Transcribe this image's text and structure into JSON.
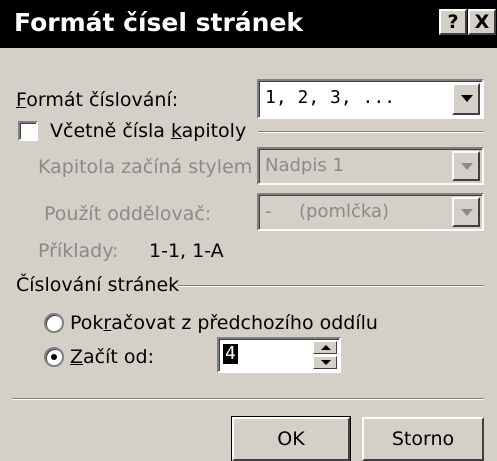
{
  "window": {
    "title": "Formát čísel stránek",
    "help_button": "?",
    "close_button": "X"
  },
  "number_format": {
    "label_first": "F",
    "label_rest": "ormát číslování:",
    "value": "1, 2, 3, ..."
  },
  "include_chapter": {
    "label_pre": "Včetně čísla ",
    "label_underline": "k",
    "label_post": "apitoly",
    "checked": false
  },
  "chapter_style": {
    "label": "Kapitola začíná stylem",
    "value": "Nadpis 1"
  },
  "separator": {
    "label": "Použít oddělovač:",
    "value_symbol": "-",
    "value_text": "(pomlčka)"
  },
  "examples": {
    "label": "Příklady:",
    "value": "1-1, 1-A"
  },
  "page_numbering": {
    "group_label": "Číslování stránek",
    "continue_option": {
      "label_pre": "Pok",
      "label_underline": "r",
      "label_post": "ačovat z předchozího oddílu",
      "selected": false
    },
    "start_option": {
      "label_underline": "Z",
      "label_post": "ačít od:",
      "selected": true
    },
    "start_value": "4"
  },
  "buttons": {
    "ok": "OK",
    "cancel": "Storno"
  },
  "colors": {
    "face": "#d4d0c8",
    "titlebar": "#000000",
    "disabled_text": "#8a8a8a"
  }
}
